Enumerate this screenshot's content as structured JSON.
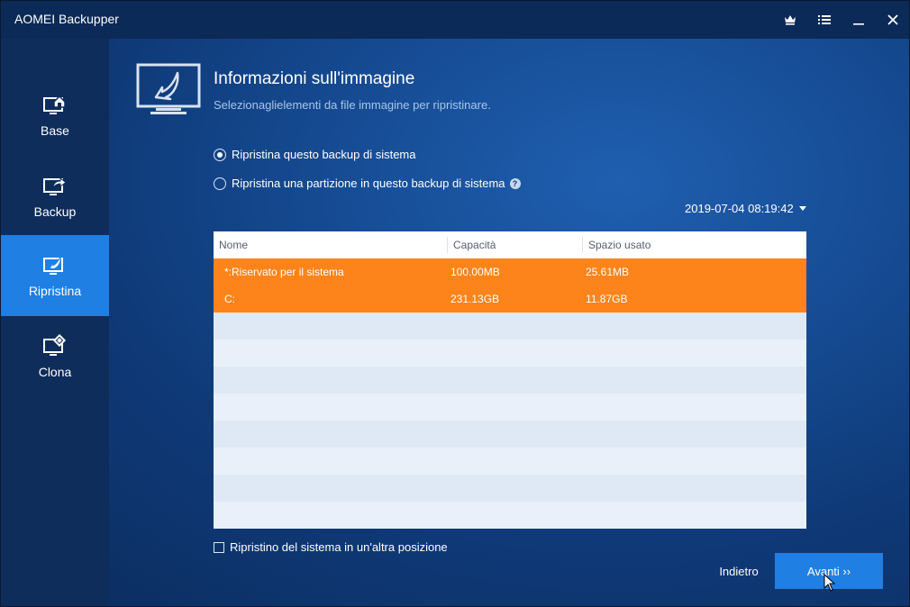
{
  "window": {
    "title": "AOMEI Backupper",
    "controls": [
      "crown-icon",
      "menu-icon",
      "minimize-icon",
      "close-icon"
    ]
  },
  "sidebar": {
    "items": [
      {
        "label": "Base",
        "icon": "home-monitor-icon",
        "active": false
      },
      {
        "label": "Backup",
        "icon": "backup-monitor-icon",
        "active": false
      },
      {
        "label": "Ripristina",
        "icon": "restore-monitor-icon",
        "active": true
      },
      {
        "label": "Clona",
        "icon": "clone-monitor-icon",
        "active": false
      }
    ]
  },
  "page": {
    "title": "Informazioni sull'immagine",
    "subtitle": "Selezionaglielementi da file immagine per ripristinare."
  },
  "options": {
    "restore_system_backup": "Ripristina questo backup di sistema",
    "restore_partition": "Ripristina una partizione in questo backup di sistema",
    "selected": "restore_system_backup"
  },
  "backup_date": "2019-07-04 08:19:42",
  "table": {
    "columns": [
      "Nome",
      "Capacità",
      "Spazio usato"
    ],
    "rows": [
      {
        "name": "*:Riservato per il sistema",
        "capacity": "100.00MB",
        "used": "25.61MB"
      },
      {
        "name": "C:",
        "capacity": "231.13GB",
        "used": "11.87GB"
      }
    ]
  },
  "alt_location_label": "Ripristino del sistema in un'altra posizione",
  "buttons": {
    "back": "Indietro",
    "next": "Avanti ››"
  },
  "colors": {
    "accent": "#1f7fe3",
    "selection": "#fd841a",
    "titlebar": "#0c2a57",
    "sidebar": "#0e2d5b"
  }
}
